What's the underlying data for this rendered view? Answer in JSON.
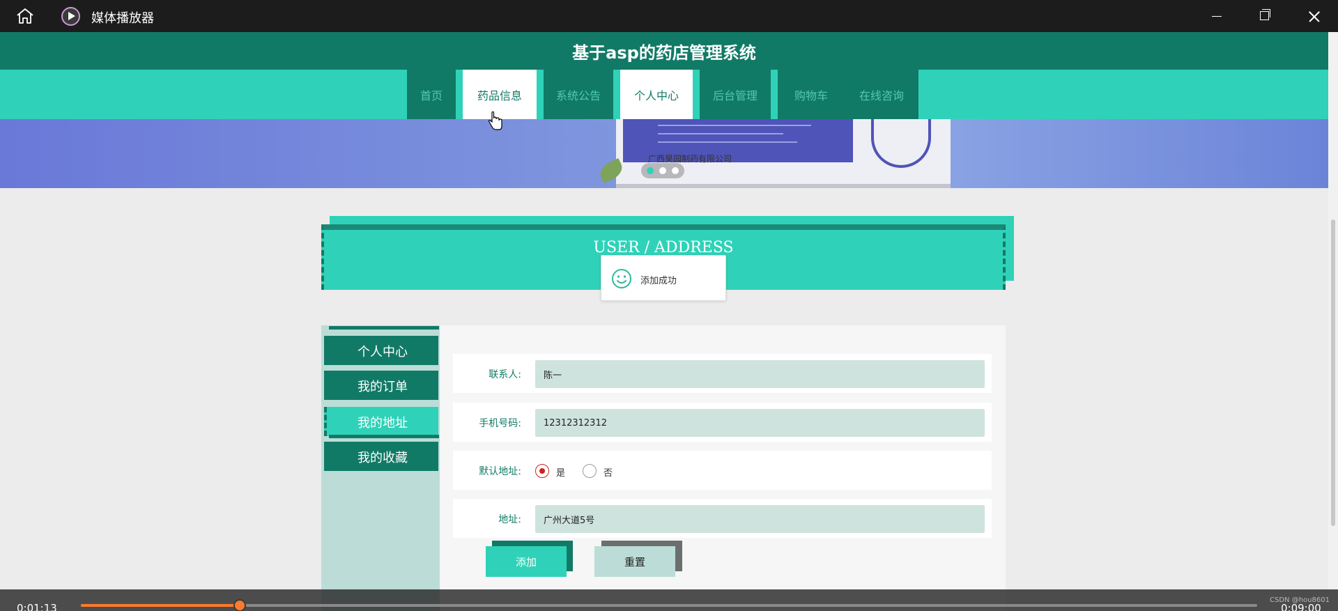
{
  "window": {
    "title": "媒体播放器"
  },
  "site": {
    "title": "基于asp的药店管理系统"
  },
  "nav": [
    {
      "label": "首页"
    },
    {
      "label": "药品信息"
    },
    {
      "label": "系统公告"
    },
    {
      "label": "个人中心"
    },
    {
      "label": "后台管理"
    },
    {
      "label": "购物车"
    },
    {
      "label": "在线咨询"
    }
  ],
  "nav_active": "个人中心",
  "banner": {
    "company": "广西昊园制药有限公司",
    "slide_count": 3,
    "active_slide": 1
  },
  "section": {
    "title": "USER / ADDRESS"
  },
  "toast": {
    "message": "添加成功"
  },
  "sidebar": [
    {
      "label": "个人中心"
    },
    {
      "label": "我的订单"
    },
    {
      "label": "我的地址"
    },
    {
      "label": "我的收藏"
    }
  ],
  "sidebar_active": "我的地址",
  "form": {
    "contact_label": "联系人:",
    "contact_value": "陈一",
    "phone_label": "手机号码:",
    "phone_value": "12312312312",
    "default_label": "默认地址:",
    "default_yes": "是",
    "default_no": "否",
    "default_selected": "是",
    "address_label": "地址:",
    "address_value": "广州大道5号",
    "add_button": "添加",
    "reset_button": "重置"
  },
  "player": {
    "current_time": "0:01:13",
    "total_time": "0:09:00",
    "progress": 0.135
  },
  "watermark": "CSDN @hou8601",
  "colors": {
    "primary": "#117a66",
    "accent": "#2fd2b8",
    "seek": "#ff7a2b"
  }
}
